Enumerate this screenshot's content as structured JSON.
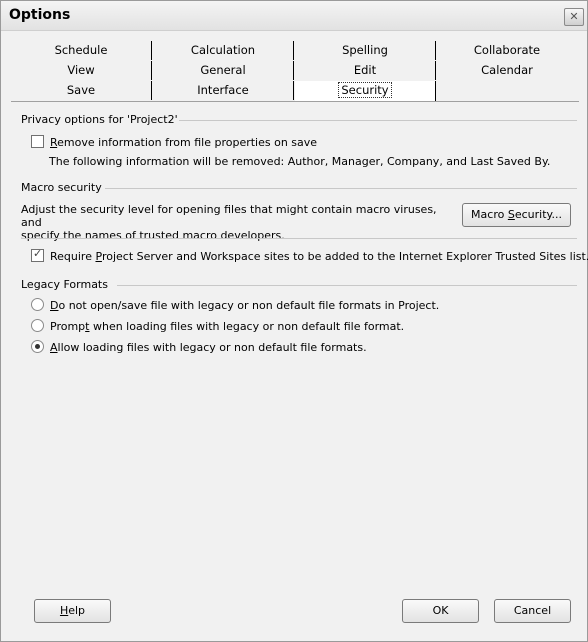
{
  "window": {
    "title": "Options",
    "close_icon": "close-icon"
  },
  "tabs": {
    "row1": [
      "Schedule",
      "Calculation",
      "Spelling",
      "Collaborate"
    ],
    "row2": [
      "View",
      "General",
      "Edit",
      "Calendar"
    ],
    "row3": [
      "Save",
      "Interface",
      "Security"
    ],
    "active": "Security"
  },
  "privacy": {
    "group_label": "Privacy options for 'Project2'",
    "remove_info": {
      "ul": "R",
      "rest": "emove information from file properties on save",
      "checked": false
    },
    "info_text": "The following information will be removed: Author, Manager, Company, and Last Saved By."
  },
  "macro": {
    "group_label": "Macro security",
    "description_1": "Adjust the security level for opening files that might contain macro viruses, and",
    "description_2": "specify the names of trusted macro developers.",
    "button": {
      "pre": "Macro ",
      "ul": "S",
      "post": "ecurity..."
    }
  },
  "trusted_sites": {
    "pre": "Require ",
    "ul": "P",
    "post": "roject Server and Workspace sites to be added to the Internet Explorer Trusted Sites list.",
    "checked": true
  },
  "legacy": {
    "group_label": "Legacy Formats",
    "options": [
      {
        "ul": "D",
        "rest": "o not open/save file with legacy or non default file formats in Project.",
        "selected": false
      },
      {
        "pre": "Promp",
        "ul": "t",
        "rest": " when loading files with legacy or non default file format.",
        "selected": false
      },
      {
        "ul": "A",
        "rest": "llow loading files with legacy or non default file formats.",
        "selected": true
      }
    ]
  },
  "buttons": {
    "help": {
      "ul": "H",
      "rest": "elp"
    },
    "ok": "OK",
    "cancel": "Cancel"
  }
}
